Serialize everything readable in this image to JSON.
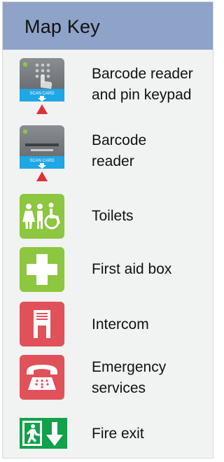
{
  "header": {
    "title": "Map Key"
  },
  "items": [
    {
      "label_line1": "Barcode reader",
      "label_line2": "and pin keypad",
      "icon": "barcode-keypad-icon",
      "icon_text": "SCAN CARD"
    },
    {
      "label_line1": "Barcode",
      "label_line2": "reader",
      "icon": "barcode-reader-icon",
      "icon_text": "SCAN CARD"
    },
    {
      "label": "Toilets",
      "icon": "toilets-icon"
    },
    {
      "label": "First aid box",
      "icon": "first-aid-icon"
    },
    {
      "label": "Intercom",
      "icon": "intercom-icon"
    },
    {
      "label_line1": "Emergency",
      "label_line2": "services",
      "icon": "telephone-icon"
    },
    {
      "label": "Fire exit",
      "icon": "fire-exit-icon"
    }
  ],
  "colors": {
    "header": "#8fa2c7",
    "panel": "#f1f2f2",
    "scan_blue": "#1ea7e4",
    "arrow_red": "#e0313a",
    "green": "#8dc63f",
    "red": "#e05159",
    "exit_green": "#10a14a"
  }
}
